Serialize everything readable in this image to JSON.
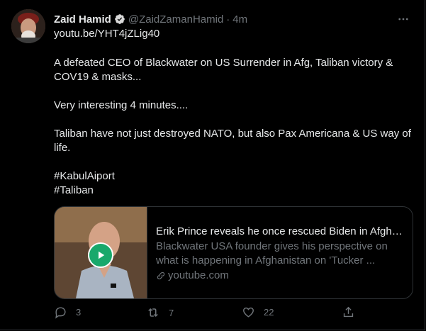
{
  "tweet": {
    "author_name": "Zaid Hamid",
    "handle": "@ZaidZamanHamid",
    "separator": "·",
    "time": "4m",
    "link": "youtu.be/YHT4jZLig40",
    "lines": [
      "A defeated CEO of Blackwater on US Surrender in Afg, Taliban victory &",
      "COV19 & masks...",
      "Very interesting 4 minutes....",
      "Taliban have not just destroyed NATO, but also Pax Americana & US way of",
      "life."
    ],
    "hashtags": [
      "#KabulAiport",
      "#Taliban"
    ]
  },
  "card": {
    "title": "Erik Prince reveals he once rescued Biden in Afgha...",
    "description_line1": "Blackwater USA founder gives his perspective on",
    "description_line2": "what is happening in Afghanistan on 'Tucker ...",
    "domain": "youtube.com"
  },
  "actions": {
    "reply_count": "3",
    "retweet_count": "7",
    "like_count": "22"
  },
  "colors": {
    "background": "#000000",
    "link": "#1fa672",
    "secondary_text": "#71767b",
    "verified": "#1d9bf0",
    "play_button": "#18a86b"
  },
  "icons": [
    "verified-badge-icon",
    "more-icon",
    "play-icon",
    "link-icon",
    "reply-icon",
    "retweet-icon",
    "like-icon",
    "share-icon"
  ]
}
